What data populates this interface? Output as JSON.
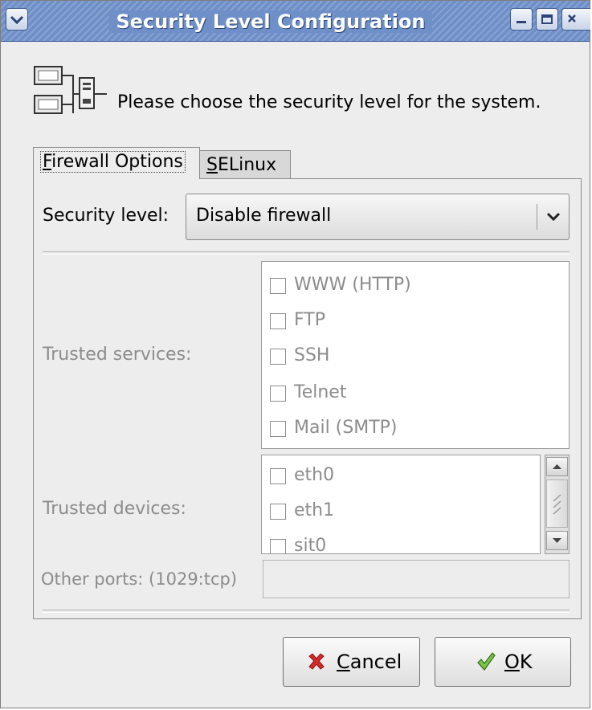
{
  "window": {
    "title": "Security Level Configuration",
    "accent": "#6e8fc7"
  },
  "titlebar_buttons": {
    "menu_icon": "chevron-down-icon",
    "minimize_icon": "minimize-icon",
    "maximize_icon": "maximize-icon",
    "close_icon": "close-icon"
  },
  "header": {
    "icon": "network-computers-icon",
    "text": "Please choose the security level for the system."
  },
  "tabs": [
    {
      "mnemonic": "F",
      "rest": "irewall Options",
      "active": true
    },
    {
      "mnemonic": "S",
      "rest": "ELinux",
      "active": false
    }
  ],
  "firewall": {
    "security_level_label": "Security level:",
    "security_level_value": "Disable firewall",
    "trusted_services_label": "Trusted services:",
    "trusted_services": [
      {
        "label": "WWW (HTTP)",
        "checked": false
      },
      {
        "label": "FTP",
        "checked": false
      },
      {
        "label": "SSH",
        "checked": false
      },
      {
        "label": "Telnet",
        "checked": false
      },
      {
        "label": "Mail (SMTP)",
        "checked": false
      }
    ],
    "trusted_devices_label": "Trusted devices:",
    "trusted_devices": [
      {
        "label": "eth0",
        "checked": false
      },
      {
        "label": "eth1",
        "checked": false
      },
      {
        "label": "sit0",
        "checked": false
      }
    ],
    "other_ports_label": "Other ports: (1029:tcp)",
    "other_ports_value": ""
  },
  "buttons": {
    "cancel": {
      "mnemonic": "C",
      "rest": "ancel",
      "icon": "red-x-icon"
    },
    "ok": {
      "mnemonic": "O",
      "rest": "K",
      "icon": "green-check-icon"
    }
  }
}
